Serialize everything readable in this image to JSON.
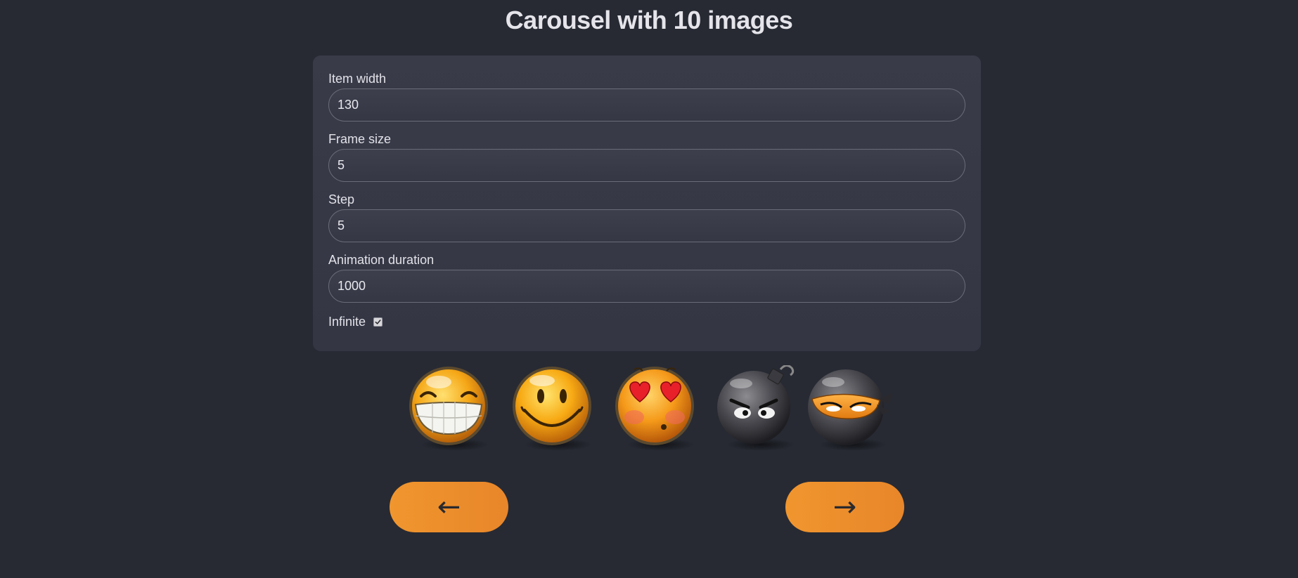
{
  "page": {
    "title": "Carousel with 10 images"
  },
  "settings": {
    "item_width": {
      "label": "Item width",
      "value": "130"
    },
    "frame_size": {
      "label": "Frame size",
      "value": "5"
    },
    "step": {
      "label": "Step",
      "value": "5"
    },
    "animation_duration": {
      "label": "Animation duration",
      "value": "1000"
    },
    "infinite": {
      "label": "Infinite",
      "checked": true
    }
  },
  "carousel": {
    "visible_items": [
      {
        "name": "grin-emoji"
      },
      {
        "name": "smile-emoji"
      },
      {
        "name": "heart-eyes-emoji"
      },
      {
        "name": "angry-bomb-emoji"
      },
      {
        "name": "ninja-emoji"
      }
    ]
  },
  "controls": {
    "prev_label": "←",
    "next_label": "→",
    "accent_color": "#ef902d"
  }
}
